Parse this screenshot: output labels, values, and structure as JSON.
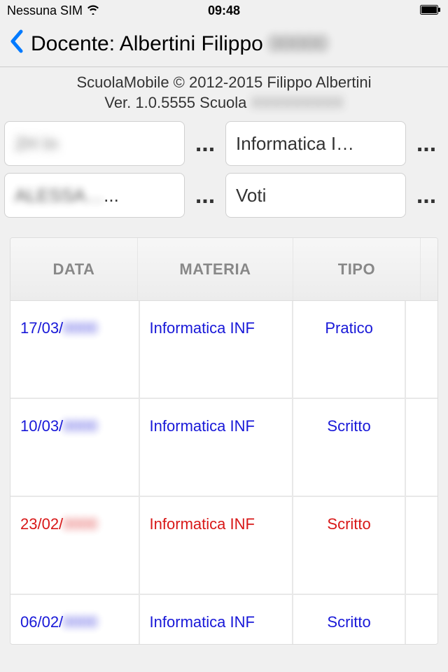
{
  "status_bar": {
    "sim": "Nessuna SIM",
    "time": "09:48"
  },
  "nav": {
    "title_prefix": "Docente: Albertini Filippo",
    "title_obscured": "00000"
  },
  "info": {
    "copyright": "ScuolaMobile © 2012-2015 Filippo Albertini",
    "version_prefix": "Ver. 1.0.5555 Scuola",
    "version_obscured": "XXXXXXXXX"
  },
  "filters": {
    "class_obscured": "2H In",
    "subject": "Informatica  I…",
    "student_obscured": "ALESSA…",
    "view": "Voti",
    "ellipsis": "..."
  },
  "table": {
    "headers": {
      "data": "DATA",
      "materia": "MATERIA",
      "tipo": "TIPO"
    },
    "rows": [
      {
        "data_prefix": "17/03/",
        "data_obscured": "0000",
        "materia": "Informatica INF",
        "tipo": "Pratico",
        "red": false
      },
      {
        "data_prefix": "10/03/",
        "data_obscured": "0000",
        "materia": "Informatica INF",
        "tipo": "Scritto",
        "red": false
      },
      {
        "data_prefix": "23/02/",
        "data_obscured": "0000",
        "materia": "Informatica INF",
        "tipo": "Scritto",
        "red": true
      },
      {
        "data_prefix": "06/02/",
        "data_obscured": "0000",
        "materia": "Informatica INF",
        "tipo": "Scritto",
        "red": false
      }
    ]
  }
}
